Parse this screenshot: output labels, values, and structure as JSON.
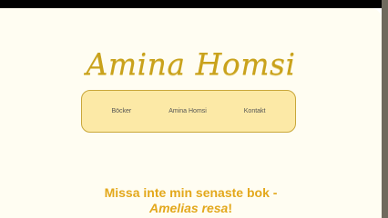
{
  "site": {
    "logo_text": "Amina Homsi"
  },
  "nav": {
    "items": [
      {
        "label": "Böcker"
      },
      {
        "label": "Amina Homsi"
      },
      {
        "label": "Kontakt"
      }
    ]
  },
  "promo": {
    "line1": "Missa inte min senaste bok -",
    "book_title": "Amelias resa",
    "suffix": "!"
  },
  "colors": {
    "accent": "#c9a21c",
    "nav_background": "#fce9a6",
    "promo_text": "#e3a81c"
  }
}
